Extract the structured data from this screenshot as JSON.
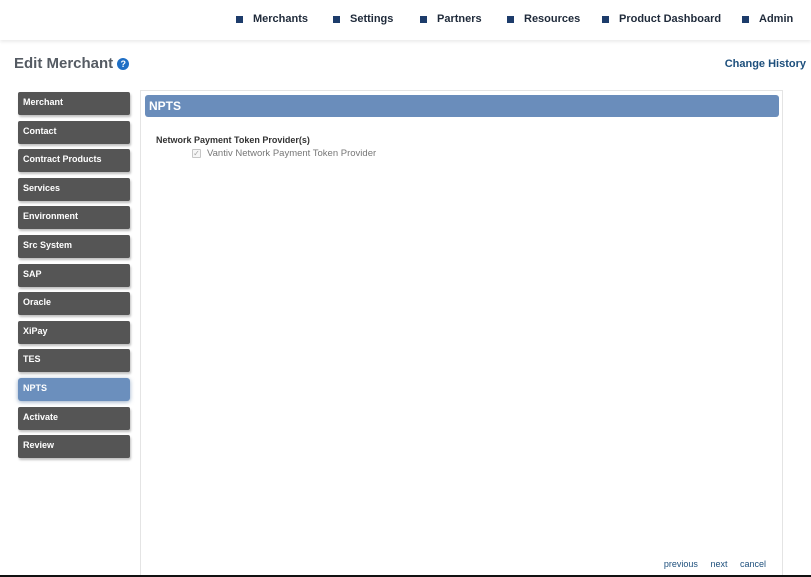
{
  "nav": {
    "items": [
      "Merchants",
      "Settings",
      "Partners",
      "Resources",
      "Product Dashboard",
      "Admin"
    ]
  },
  "header": {
    "title": "Edit Merchant",
    "help_icon": "?",
    "change_history": "Change History"
  },
  "sidebar": {
    "items": [
      "Merchant",
      "Contact",
      "Contract Products",
      "Services",
      "Environment",
      "Src System",
      "SAP",
      "Oracle",
      "XiPay",
      "TES",
      "NPTS",
      "Activate",
      "Review"
    ],
    "active": "NPTS"
  },
  "main": {
    "section_title": "NPTS",
    "group_label": "Network Payment Token Provider(s)",
    "checkbox_label": "Vantiv Network Payment Token Provider",
    "checkbox_checked": true
  },
  "footer": {
    "previous": "previous",
    "next": "next",
    "cancel": "cancel"
  },
  "colors": {
    "accent": "#6a8dbb",
    "nav_bullet": "#1d3c6b",
    "sidebar_item": "#555555",
    "link": "#1d4f7c"
  }
}
